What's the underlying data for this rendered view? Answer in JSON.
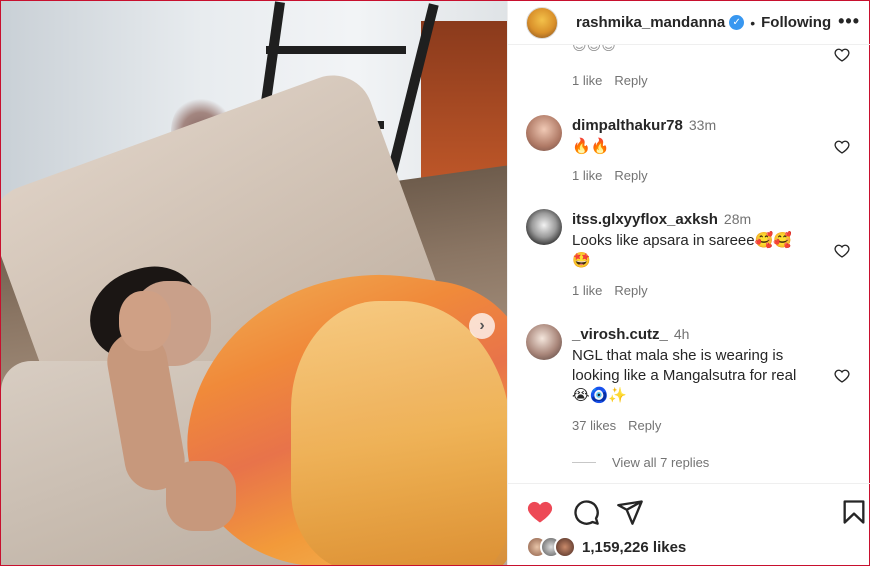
{
  "post": {
    "username": "rashmika_mandanna",
    "follow_status": "Following",
    "separator": "•",
    "more_label": "•••",
    "next_label": "›"
  },
  "comments": [
    {
      "meta_likes": "1 like",
      "reply": "Reply"
    },
    {
      "user": "dimpalthakur78",
      "time": "33m",
      "text": "🔥🔥",
      "meta_likes": "1 like",
      "reply": "Reply"
    },
    {
      "user": "itss.glxyyflox_axksh",
      "time": "28m",
      "text": "Looks like apsara in sareee🥰🥰",
      "text2": "🤩",
      "meta_likes": "1 like",
      "reply": "Reply"
    },
    {
      "user": "_virosh.cutz_",
      "time": "4h",
      "text": "NGL that mala she is wearing is looking like a Mangalsutra for real",
      "text2": "😭🧿✨",
      "meta_likes": "37 likes",
      "reply": "Reply"
    }
  ],
  "view_replies": "View all 7 replies",
  "likes": "1,159,226 likes",
  "colors": {
    "like_red": "#ed4956",
    "verified_blue": "#3897f0"
  },
  "icons": [
    "heart-filled-icon",
    "comment-icon",
    "share-icon",
    "bookmark-icon",
    "chevron-right-icon",
    "verified-icon",
    "more-icon"
  ]
}
